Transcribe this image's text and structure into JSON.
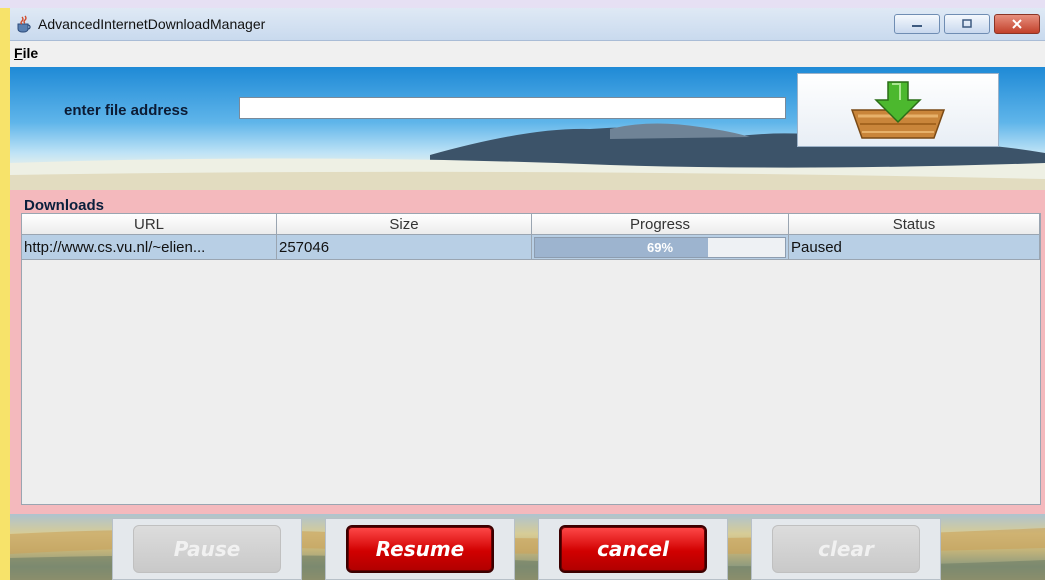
{
  "window": {
    "title": "AdvancedInternetDownloadManager",
    "icon": "java-cup-icon"
  },
  "menu": {
    "file_label": "File",
    "file_mnemonic": "F",
    "file_rest": "ile"
  },
  "address": {
    "label": "enter file address",
    "value": "",
    "placeholder": "",
    "download_icon": "download-box-icon"
  },
  "downloads": {
    "title": "Downloads",
    "columns": [
      "URL",
      "Size",
      "Progress",
      "Status"
    ],
    "rows": [
      {
        "url": "http://www.cs.vu.nl/~elien...",
        "size": "257046",
        "progress_label": "69%",
        "progress_fraction": 0.69,
        "status": "Paused"
      }
    ]
  },
  "buttons": {
    "pause": "Pause",
    "resume": "Resume",
    "cancel": "cancel",
    "clear": "clear"
  },
  "colors": {
    "accent_red": "#d10000",
    "selection_row": "#b8cfe5",
    "panel_pink": "#f4b9bd"
  }
}
